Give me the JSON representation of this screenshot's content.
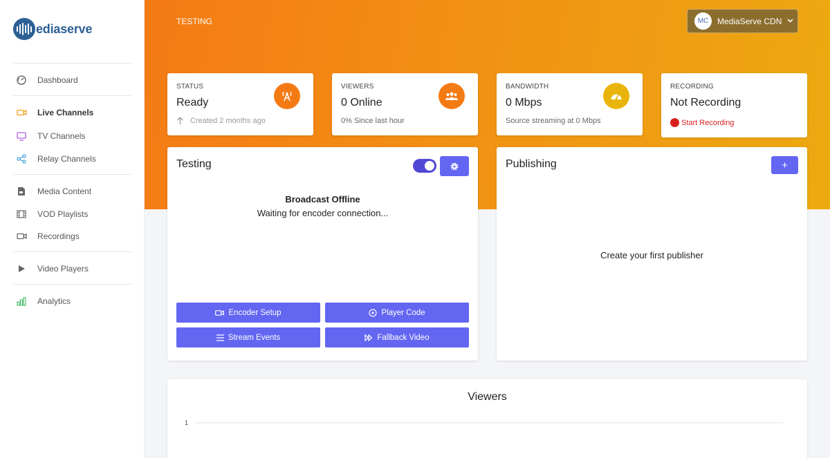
{
  "brand": {
    "logo_text": "ediaserve"
  },
  "sidebar": {
    "items": [
      {
        "label": "Dashboard",
        "icon": "dashboard-icon",
        "active": false
      },
      {
        "label": "Live Channels",
        "icon": "video-camera-icon",
        "active": true
      },
      {
        "label": "TV Channels",
        "icon": "tv-icon",
        "active": false
      },
      {
        "label": "Relay Channels",
        "icon": "share-icon",
        "active": false
      },
      {
        "label": "Media Content",
        "icon": "file-icon",
        "active": false
      },
      {
        "label": "VOD Playlists",
        "icon": "film-icon",
        "active": false
      },
      {
        "label": "Recordings",
        "icon": "video-camera-icon",
        "active": false
      },
      {
        "label": "Video Players",
        "icon": "play-icon",
        "active": false
      },
      {
        "label": "Analytics",
        "icon": "bar-chart-icon",
        "active": false
      }
    ]
  },
  "header": {
    "breadcrumb": "TESTING",
    "account": {
      "initials": "MC",
      "name": "MediaServe CDN"
    }
  },
  "stats": {
    "status": {
      "label": "STATUS",
      "value": "Ready",
      "sub": "Created 2 months ago",
      "icon": "broadcast-icon",
      "color": "#f47a14"
    },
    "viewers": {
      "label": "VIEWERS",
      "value": "0 Online",
      "sub": "0% Since last hour",
      "icon": "users-icon",
      "color": "#f47a14"
    },
    "bandwidth": {
      "label": "BANDWIDTH",
      "value": "0 Mbps",
      "sub": "Source streaming at 0 Mbps",
      "icon": "gauge-icon",
      "color": "#e9b50d"
    },
    "recording": {
      "label": "RECORDING",
      "value": "Not Recording",
      "action": "Start Recording",
      "icon": "record-dot-icon",
      "color": "#d8211e"
    }
  },
  "channel": {
    "title": "Testing",
    "enabled": true,
    "offline_title": "Broadcast Offline",
    "offline_sub": "Waiting for encoder connection...",
    "buttons": {
      "encoder_setup": "Encoder Setup",
      "player_code": "Player Code",
      "stream_events": "Stream Events",
      "fallback_video": "Fallback Video"
    }
  },
  "publishing": {
    "title": "Publishing",
    "add_label": "+",
    "empty_text": "Create your first publisher"
  },
  "viewers_chart": {
    "title": "Viewers"
  },
  "chart_data": {
    "type": "line",
    "title": "Viewers",
    "y_tick_labels": [
      "1"
    ],
    "ylim": [
      0,
      1
    ],
    "series": [],
    "grid": true
  },
  "colors": {
    "accent": "#6366f1",
    "toggle": "#4f47d6",
    "gradient_start": "#f47a14",
    "gradient_end": "#ecaa10",
    "brand": "#2c5f95"
  }
}
